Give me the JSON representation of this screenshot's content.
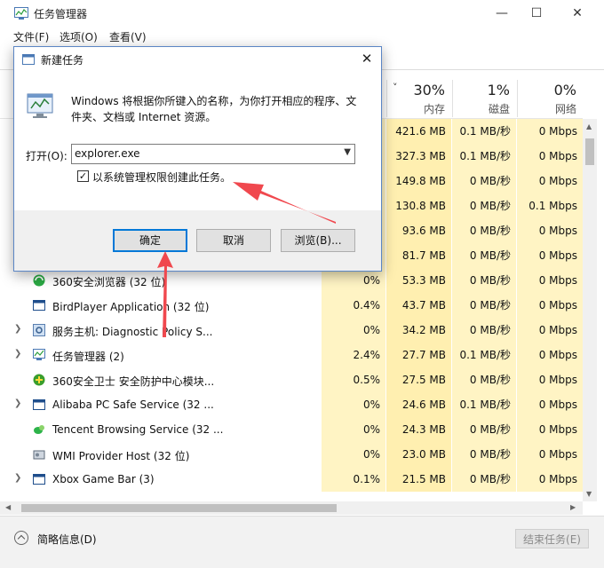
{
  "window": {
    "title": "任务管理器",
    "minimize_glyph": "—",
    "maximize_glyph": "☐",
    "close_glyph": "✕",
    "icon": "task-manager-icon"
  },
  "menu": {
    "file": "文件(F)",
    "options": "选项(O)",
    "view": "查看(V)"
  },
  "columns": {
    "sort_glyph": "˅",
    "cpu": {
      "pct": "",
      "label": ""
    },
    "memory": {
      "pct": "30%",
      "label": "内存"
    },
    "disk": {
      "pct": "1%",
      "label": "磁盘"
    },
    "network": {
      "pct": "0%",
      "label": "网络"
    }
  },
  "rows": [
    {
      "name": "",
      "cpu": "",
      "memory": "421.6 MB",
      "disk": "0.1 MB/秒",
      "network": "0 Mbps",
      "expandable": false
    },
    {
      "name": "",
      "cpu": "",
      "memory": "327.3 MB",
      "disk": "0.1 MB/秒",
      "network": "0 Mbps",
      "expandable": false
    },
    {
      "name": "",
      "cpu": "",
      "memory": "149.8 MB",
      "disk": "0 MB/秒",
      "network": "0 Mbps",
      "expandable": false
    },
    {
      "name": "",
      "cpu": "",
      "memory": "130.8 MB",
      "disk": "0 MB/秒",
      "network": "0.1 Mbps",
      "expandable": false
    },
    {
      "name": "",
      "cpu": "",
      "memory": "93.6 MB",
      "disk": "0 MB/秒",
      "network": "0 Mbps",
      "expandable": false
    },
    {
      "name": "",
      "cpu": "",
      "memory": "81.7 MB",
      "disk": "0 MB/秒",
      "network": "0 Mbps",
      "expandable": false
    },
    {
      "name": "360安全浏览器 (32 位)",
      "cpu": "0%",
      "memory": "53.3 MB",
      "disk": "0 MB/秒",
      "network": "0 Mbps",
      "expandable": false,
      "icon": "browser-360-icon"
    },
    {
      "name": "BirdPlayer Application (32 位)",
      "cpu": "0.4%",
      "memory": "43.7 MB",
      "disk": "0 MB/秒",
      "network": "0 Mbps",
      "expandable": false,
      "icon": "app-window-icon"
    },
    {
      "name": "服务主机: Diagnostic Policy S...",
      "cpu": "0%",
      "memory": "34.2 MB",
      "disk": "0 MB/秒",
      "network": "0 Mbps",
      "expandable": true,
      "icon": "gear-icon"
    },
    {
      "name": "任务管理器 (2)",
      "cpu": "2.4%",
      "memory": "27.7 MB",
      "disk": "0.1 MB/秒",
      "network": "0 Mbps",
      "expandable": true,
      "icon": "task-manager-icon"
    },
    {
      "name": "360安全卫士 安全防护中心模块...",
      "cpu": "0.5%",
      "memory": "27.5 MB",
      "disk": "0 MB/秒",
      "network": "0 Mbps",
      "expandable": false,
      "icon": "security-360-icon"
    },
    {
      "name": "Alibaba PC Safe Service (32 ...",
      "cpu": "0%",
      "memory": "24.6 MB",
      "disk": "0.1 MB/秒",
      "network": "0 Mbps",
      "expandable": true,
      "icon": "app-window-icon"
    },
    {
      "name": "Tencent Browsing Service (32 ...",
      "cpu": "0%",
      "memory": "24.3 MB",
      "disk": "0 MB/秒",
      "network": "0 Mbps",
      "expandable": false,
      "icon": "tencent-icon"
    },
    {
      "name": "WMI Provider Host (32 位)",
      "cpu": "0%",
      "memory": "23.0 MB",
      "disk": "0 MB/秒",
      "network": "0 Mbps",
      "expandable": false,
      "icon": "wmi-host-icon"
    },
    {
      "name": "Xbox Game Bar (3)",
      "cpu": "0.1%",
      "memory": "21.5 MB",
      "disk": "0 MB/秒",
      "network": "0 Mbps",
      "expandable": true,
      "icon": "app-window-icon"
    }
  ],
  "footer": {
    "fewer_details": "简略信息(D)",
    "end_task": "结束任务(E)"
  },
  "dialog": {
    "title": "新建任务",
    "close_glyph": "✕",
    "description": "Windows 将根据你所键入的名称，为你打开相应的程序、文件夹、文档或 Internet 资源。",
    "open_label": "打开(O):",
    "open_value": "explorer.exe",
    "admin_checkbox_label": "以系统管理权限创建此任务。",
    "admin_checked": true,
    "check_glyph": "✓",
    "ok": "确定",
    "cancel": "取消",
    "browse": "浏览(B)..."
  },
  "colors": {
    "annotation_arrow": "#f0484e",
    "accent": "#0078d7",
    "cpu_fill": "#fff4c4"
  }
}
